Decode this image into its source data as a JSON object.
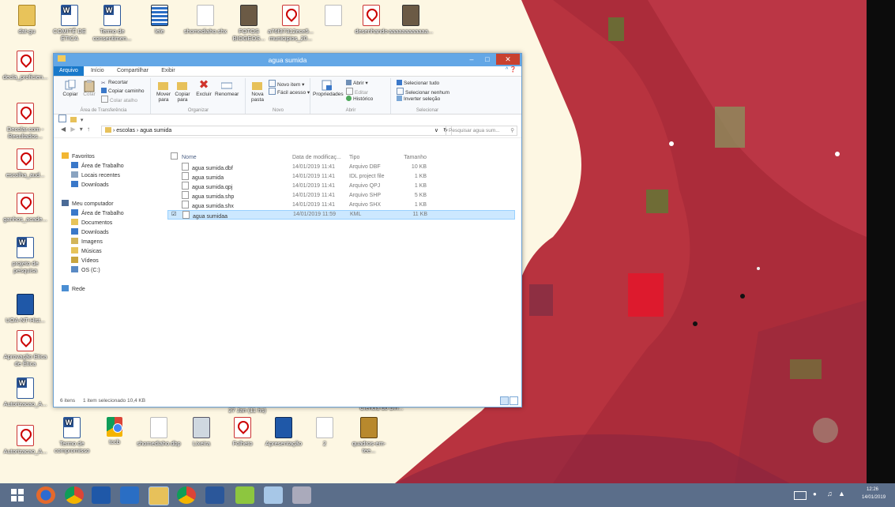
{
  "desktop": {
    "icons_top": [
      {
        "label": "dat-gu",
        "type": "folder"
      },
      {
        "label": "COMITÊ DE ÉTICA",
        "type": "word"
      },
      {
        "label": "Termo de consentimen...",
        "type": "word"
      },
      {
        "label": "lele",
        "type": "grid"
      },
      {
        "label": "shomediaho.shx",
        "type": "doc"
      },
      {
        "label": "FOTOS BIOGEOS...",
        "type": "photo"
      },
      {
        "label": "a76f37312ece5... municipios_20...",
        "type": "pdf"
      },
      {
        "label": "",
        "type": "doc"
      },
      {
        "label": "desenhando",
        "type": "pdf"
      },
      {
        "label": "aaaaaaaaaaaa...",
        "type": "photo"
      }
    ],
    "icons_left": [
      {
        "label": "decla_proficien...",
        "type": "pdf"
      },
      {
        "label": "Decolar.com - Resultados...",
        "type": "pdf"
      },
      {
        "label": "escolha_aud...",
        "type": "pdf"
      },
      {
        "label": "ganhos_acade...",
        "type": "pdf"
      },
      {
        "label": "projeto de pesquisa",
        "type": "word"
      },
      {
        "label": "UOA-NT-Hist...",
        "type": "blue"
      },
      {
        "label": "Aprovação Etica de Ética",
        "type": "pdf"
      },
      {
        "label": "Autorizacao_A...",
        "type": "word"
      },
      {
        "label": "Autorizacao_A...",
        "type": "pdf"
      }
    ],
    "icons_bottom": [
      {
        "label": "Termo de compromisso",
        "type": "word"
      },
      {
        "label": "tccb",
        "type": "chrome"
      },
      {
        "label": "shomediaho.dbp",
        "type": "doc"
      },
      {
        "label": "Lixeira",
        "type": "bin"
      },
      {
        "label": "Folheto",
        "type": "pdf"
      },
      {
        "label": "Apresentação",
        "type": "blue"
      },
      {
        "label": "2",
        "type": "doc"
      },
      {
        "label": "quadros-em-tee...",
        "type": "gold"
      }
    ],
    "hidden_labels": [
      "Ciência do Din...",
      "27 Jan (11 hs)"
    ]
  },
  "window": {
    "title": "agua sumida",
    "ribbon_tabs": [
      "Arquivo",
      "Início",
      "Compartilhar",
      "Exibir"
    ],
    "clipboard": {
      "copy": "Copiar",
      "paste": "Colar",
      "cut": "Recortar",
      "copy_path": "Copiar caminho",
      "paste_shortcut": "Colar atalho",
      "group": "Área de Transferência"
    },
    "organize": {
      "move": "Mover para",
      "copy_to": "Copiar para",
      "delete": "Excluir",
      "rename": "Renomear",
      "group": "Organizar"
    },
    "new": {
      "new_folder": "Nova pasta",
      "new_item": "Novo item",
      "easy_access": "Fácil acesso",
      "group": "Novo"
    },
    "open": {
      "properties": "Propriedades",
      "open": "Abrir",
      "edit": "Editar",
      "history": "Histórico",
      "group": "Abrir"
    },
    "select": {
      "select_all": "Selecionar tudo",
      "select_none": "Selecionar nenhum",
      "invert": "Inverter seleção",
      "group": "Selecionar"
    },
    "path": [
      "escolas",
      "agua sumida"
    ],
    "search_placeholder": "Pesquisar agua sum...",
    "nav_tree": [
      {
        "label": "Favoritos",
        "level": 0,
        "color": "#f2b632"
      },
      {
        "label": "Área de Trabalho",
        "level": 1,
        "color": "#3a78c9"
      },
      {
        "label": "Locais recentes",
        "level": 1,
        "color": "#8aa3c0"
      },
      {
        "label": "Downloads",
        "level": 1,
        "color": "#3a78c9"
      },
      {
        "label": "",
        "level": 0,
        "color": ""
      },
      {
        "label": "Meu computador",
        "level": 0,
        "color": "#4a6a96"
      },
      {
        "label": "Área de Trabalho",
        "level": 1,
        "color": "#3a78c9"
      },
      {
        "label": "Documentos",
        "level": 1,
        "color": "#e6c35a"
      },
      {
        "label": "Downloads",
        "level": 1,
        "color": "#3a78c9"
      },
      {
        "label": "Imagens",
        "level": 1,
        "color": "#d2b55a"
      },
      {
        "label": "Músicas",
        "level": 1,
        "color": "#e6c35a"
      },
      {
        "label": "Vídeos",
        "level": 1,
        "color": "#c9a53e"
      },
      {
        "label": "OS (C:)",
        "level": 1,
        "color": "#5a8ac4"
      },
      {
        "label": "",
        "level": 0,
        "color": ""
      },
      {
        "label": "Rede",
        "level": 0,
        "color": "#4a8ed3"
      }
    ],
    "columns": [
      "Nome",
      "Data de modificaç...",
      "Tipo",
      "Tamanho"
    ],
    "files": [
      {
        "name": "agua sumida.dbf",
        "date": "14/01/2019 11:41",
        "type": "Arquivo DBF",
        "size": "10 KB",
        "selected": false
      },
      {
        "name": "agua sumida",
        "date": "14/01/2019 11:41",
        "type": "IDL project file",
        "size": "1 KB",
        "selected": false
      },
      {
        "name": "agua sumida.qpj",
        "date": "14/01/2019 11:41",
        "type": "Arquivo QPJ",
        "size": "1 KB",
        "selected": false
      },
      {
        "name": "agua sumida.shp",
        "date": "14/01/2019 11:41",
        "type": "Arquivo SHP",
        "size": "5 KB",
        "selected": false
      },
      {
        "name": "agua sumida.shx",
        "date": "14/01/2019 11:41",
        "type": "Arquivo SHX",
        "size": "1 KB",
        "selected": false
      },
      {
        "name": "agua sumidaa",
        "date": "14/01/2019 11:59",
        "type": "KML",
        "size": "11 KB",
        "selected": true
      }
    ],
    "status": {
      "items": "6 itens",
      "selected": "1 item selecionado 10,4 KB"
    }
  },
  "taskbar": {
    "time": "12:26",
    "date": "14/01/2019",
    "color": "#5b6e8a"
  }
}
